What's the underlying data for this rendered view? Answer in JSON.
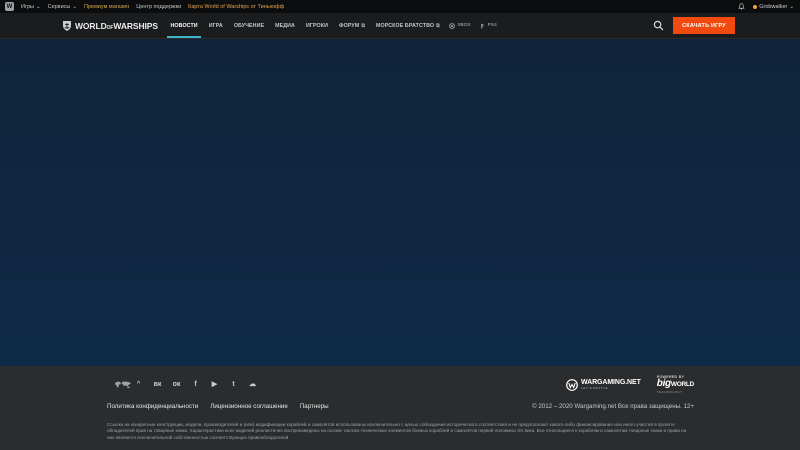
{
  "topbar": {
    "logo_letter": "W",
    "items": [
      {
        "label": "Игры",
        "arrow": "⌄"
      },
      {
        "label": "Сервисы",
        "arrow": "⌄"
      },
      {
        "label": "Премиум магазин"
      },
      {
        "label": "Центр поддержки"
      },
      {
        "label": "Карта World of Warships от Тинькофф"
      }
    ],
    "username": "Grobwalker",
    "user_arrow": "⌄"
  },
  "nav": {
    "brand_pre": "WORLD",
    "brand_of": "OF",
    "brand_post": "WARSHIPS",
    "items": [
      {
        "label": "НОВОСТИ",
        "active": true
      },
      {
        "label": "ИГРА"
      },
      {
        "label": "ОБУЧЕНИЕ"
      },
      {
        "label": "МЕДИА"
      },
      {
        "label": "ИГРОКИ"
      },
      {
        "label": "ФОРУМ",
        "external": "⧉"
      },
      {
        "label": "МОРСКОЕ БРАТСТВО",
        "external": "⧉"
      }
    ],
    "platform_xbox": "XBOX",
    "platform_ps": "PS4",
    "download_label": "СКАЧАТЬ ИГРУ",
    "accent_color": "#3fb3c8",
    "download_color": "#f04a0f"
  },
  "footer": {
    "region_arrow": "^",
    "social_icons": [
      "vk-icon",
      "odnoklassniki-icon",
      "facebook-icon",
      "youtube-icon",
      "twitter-icon",
      "soundcloud-icon"
    ],
    "social_glyphs": {
      "vk": "вк",
      "ok": "ок",
      "fb": "f",
      "yt": "▶",
      "tw": "t",
      "sc": "☁"
    },
    "wargaming_name": "WARGAMING.NET",
    "wargaming_tagline": "LET'S BATTLE",
    "powered_by": "POWERED BY",
    "bigworld_big": "big",
    "bigworld_world": "WORLD",
    "bigworld_tech": "TECHNOLOGY",
    "links": [
      {
        "label": "Политика конфиденциальности"
      },
      {
        "label": "Лицензионное соглашение"
      },
      {
        "label": "Партнеры"
      }
    ],
    "copyright": "© 2012 – 2020 Wargaming.net Все права защищены. 12+",
    "disclaimer": "Ссылки на конкретные конструкции, модели, производителей и (или) модификации кораблей и самолётов использованы исключительно с целью соблюдения исторического соответствия и не предполагают какого-либо финансирования или иного участия в проекте обладателей прав на товарные знаки. Характеристики всех моделей реалистично воспроизведены на основе тактико-технических элементов боевых кораблей и самолётов первой половины XX века. Все относящиеся к кораблям и самолетам товарные знаки и права на них являются исключительной собственностью соответствующих правообладателей"
  }
}
